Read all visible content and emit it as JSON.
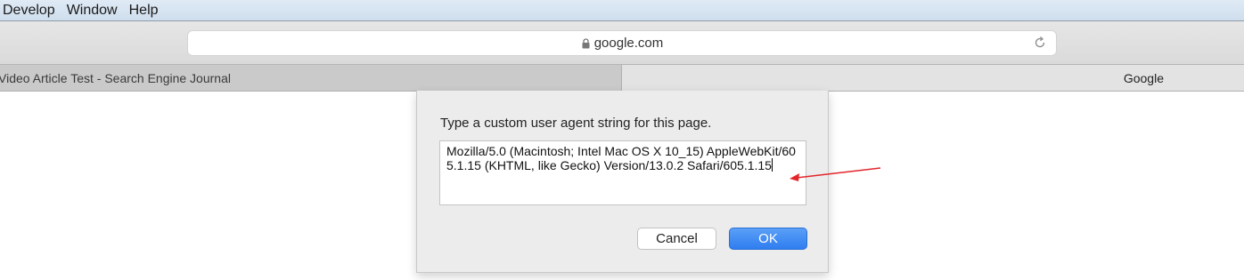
{
  "menubar": {
    "items": [
      "Develop",
      "Window",
      "Help"
    ]
  },
  "toolbar": {
    "url": "google.com",
    "lock_icon": "lock-icon",
    "reload_icon": "reload-icon"
  },
  "tabs": [
    {
      "label": "Video Article Test - Search Engine Journal",
      "active": false
    },
    {
      "label": "Google",
      "active": true
    }
  ],
  "dialog": {
    "prompt": "Type a custom user agent string for this page.",
    "user_agent": "Mozilla/5.0 (Macintosh; Intel Mac OS X 10_15) AppleWebKit/605.1.15 (KHTML, like Gecko) Version/13.0.2 Safari/605.1.15",
    "cancel_label": "Cancel",
    "ok_label": "OK"
  },
  "annotation": {
    "arrow_color": "#e3262b"
  },
  "colors": {
    "ok_button": "#2f7df0"
  }
}
